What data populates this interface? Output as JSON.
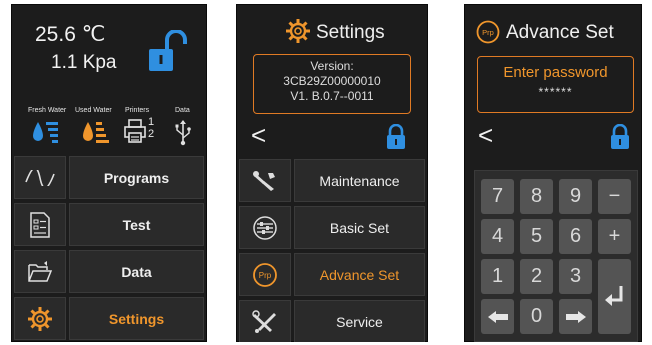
{
  "panel1": {
    "temperature": "25.6 ℃",
    "pressure": "1.1 Kpa",
    "lock_icon": "unlocked-padlock-icon",
    "indicators": [
      {
        "label": "Fresh Water",
        "icon": "fresh-water-level-icon"
      },
      {
        "label": "Used Water",
        "icon": "used-water-level-icon"
      },
      {
        "label": "Printers",
        "icon": "printer-icon",
        "value_1": "1",
        "value_2": "2"
      },
      {
        "label": "Data",
        "icon": "usb-icon"
      }
    ],
    "menu": [
      {
        "label": "Programs",
        "icon": "waveform-icon"
      },
      {
        "label": "Test",
        "icon": "document-list-icon"
      },
      {
        "label": "Data",
        "icon": "folder-open-icon"
      },
      {
        "label": "Settings",
        "icon": "gear-icon"
      }
    ]
  },
  "panel2": {
    "title": "Settings",
    "version_label": "Version:",
    "version_code": "3CB29Z00000010",
    "version_number": "V1. B.0.7--0011",
    "back": "<",
    "menu": [
      {
        "label": "Maintenance",
        "icon": "wrench-screwdriver-icon"
      },
      {
        "label": "Basic Set",
        "icon": "sliders-circle-icon"
      },
      {
        "label": "Advance Set",
        "icon": "prp-icon"
      },
      {
        "label": "Service",
        "icon": "tools-icon"
      }
    ]
  },
  "panel3": {
    "title": "Advance Set",
    "prp_badge": "Prp",
    "password_prompt": "Enter password",
    "password_mask": "******",
    "back": "<",
    "keys": [
      "7",
      "8",
      "9",
      "−",
      "4",
      "5",
      "6",
      "+",
      "1",
      "2",
      "3",
      "0"
    ]
  },
  "colors": {
    "accent": "#f0962c",
    "lock_blue": "#2f8fe0",
    "panel_bg": "#1c1c1c"
  }
}
